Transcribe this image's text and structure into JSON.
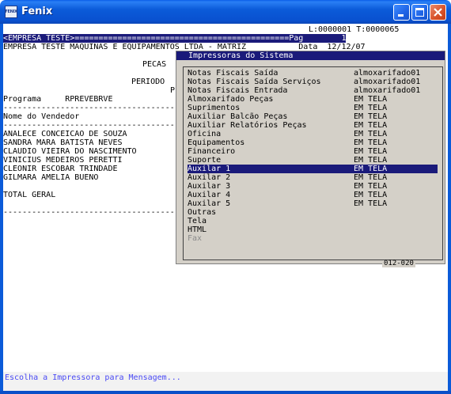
{
  "window": {
    "icon_text": "FENIX",
    "title": "Fenix"
  },
  "report": {
    "counters": "L:0000001 T:0000065",
    "header_row": "<EMPRESA TESTE>=============================================Pag        1",
    "company_line": "EMPRESA TESTE MAQUINAS E EQUIPAMENTOS LTDA - MATRIZ           Data  12/12/07",
    "pecas_label": "PECAS",
    "periodo_label": "PERIODO",
    "p_label": "P",
    "programa_line": "Programa     RPREVEBRVE",
    "separator": "-------------------------------------",
    "vendedor_header": "Nome do Vendedor",
    "vendedores": [
      "ANALECE CONCEICAO DE SOUZA",
      "SANDRA MARA BATISTA NEVES",
      "CLAUDIO VIEIRA DO NASCIMENTO",
      "VINICIUS MEDEIROS PERETTI",
      "CLEONIR ESCOBAR TRINDADE",
      "GILMARA AMELIA BUENO"
    ],
    "total_label": "TOTAL GERAL"
  },
  "popup": {
    "title": "Impressoras do Sistema",
    "footer": "012-020",
    "items": [
      {
        "label": "Notas Fiscais Saída",
        "value": "almoxarifado01"
      },
      {
        "label": "Notas Fiscais Saída Serviços",
        "value": "almoxarifado01"
      },
      {
        "label": "Notas Fiscais Entrada",
        "value": "almoxarifado01"
      },
      {
        "label": "Almoxarifado Peças",
        "value": "EM TELA"
      },
      {
        "label": "Suprimentos",
        "value": "EM TELA"
      },
      {
        "label": "Auxiliar Balcão Peças",
        "value": "EM TELA"
      },
      {
        "label": "Auxiliar Relatórios Peças",
        "value": "EM TELA"
      },
      {
        "label": "Oficina",
        "value": "EM TELA"
      },
      {
        "label": "Equipamentos",
        "value": "EM TELA"
      },
      {
        "label": "Financeiro",
        "value": "EM TELA"
      },
      {
        "label": "Suporte",
        "value": "EM TELA"
      },
      {
        "label": "Auxilar 1",
        "value": "EM TELA"
      },
      {
        "label": "Auxilar 2",
        "value": "EM TELA"
      },
      {
        "label": "Auxilar 3",
        "value": "EM TELA"
      },
      {
        "label": "Auxilar 4",
        "value": "EM TELA"
      },
      {
        "label": "Auxilar 5",
        "value": "EM TELA"
      },
      {
        "label": "Outras",
        "value": ""
      },
      {
        "label": "Tela",
        "value": ""
      },
      {
        "label": "HTML",
        "value": ""
      },
      {
        "label": "Fax",
        "value": ""
      }
    ],
    "selected_index": 11,
    "disabled_index": 19
  },
  "status": {
    "message": "Escolha a Impressora para Mensagem..."
  },
  "colors": {
    "titlebar": "#0b5bd9",
    "highlight": "#1a1a7a",
    "status_text": "#4a4af5",
    "popup_bg": "#d4d0c8"
  }
}
